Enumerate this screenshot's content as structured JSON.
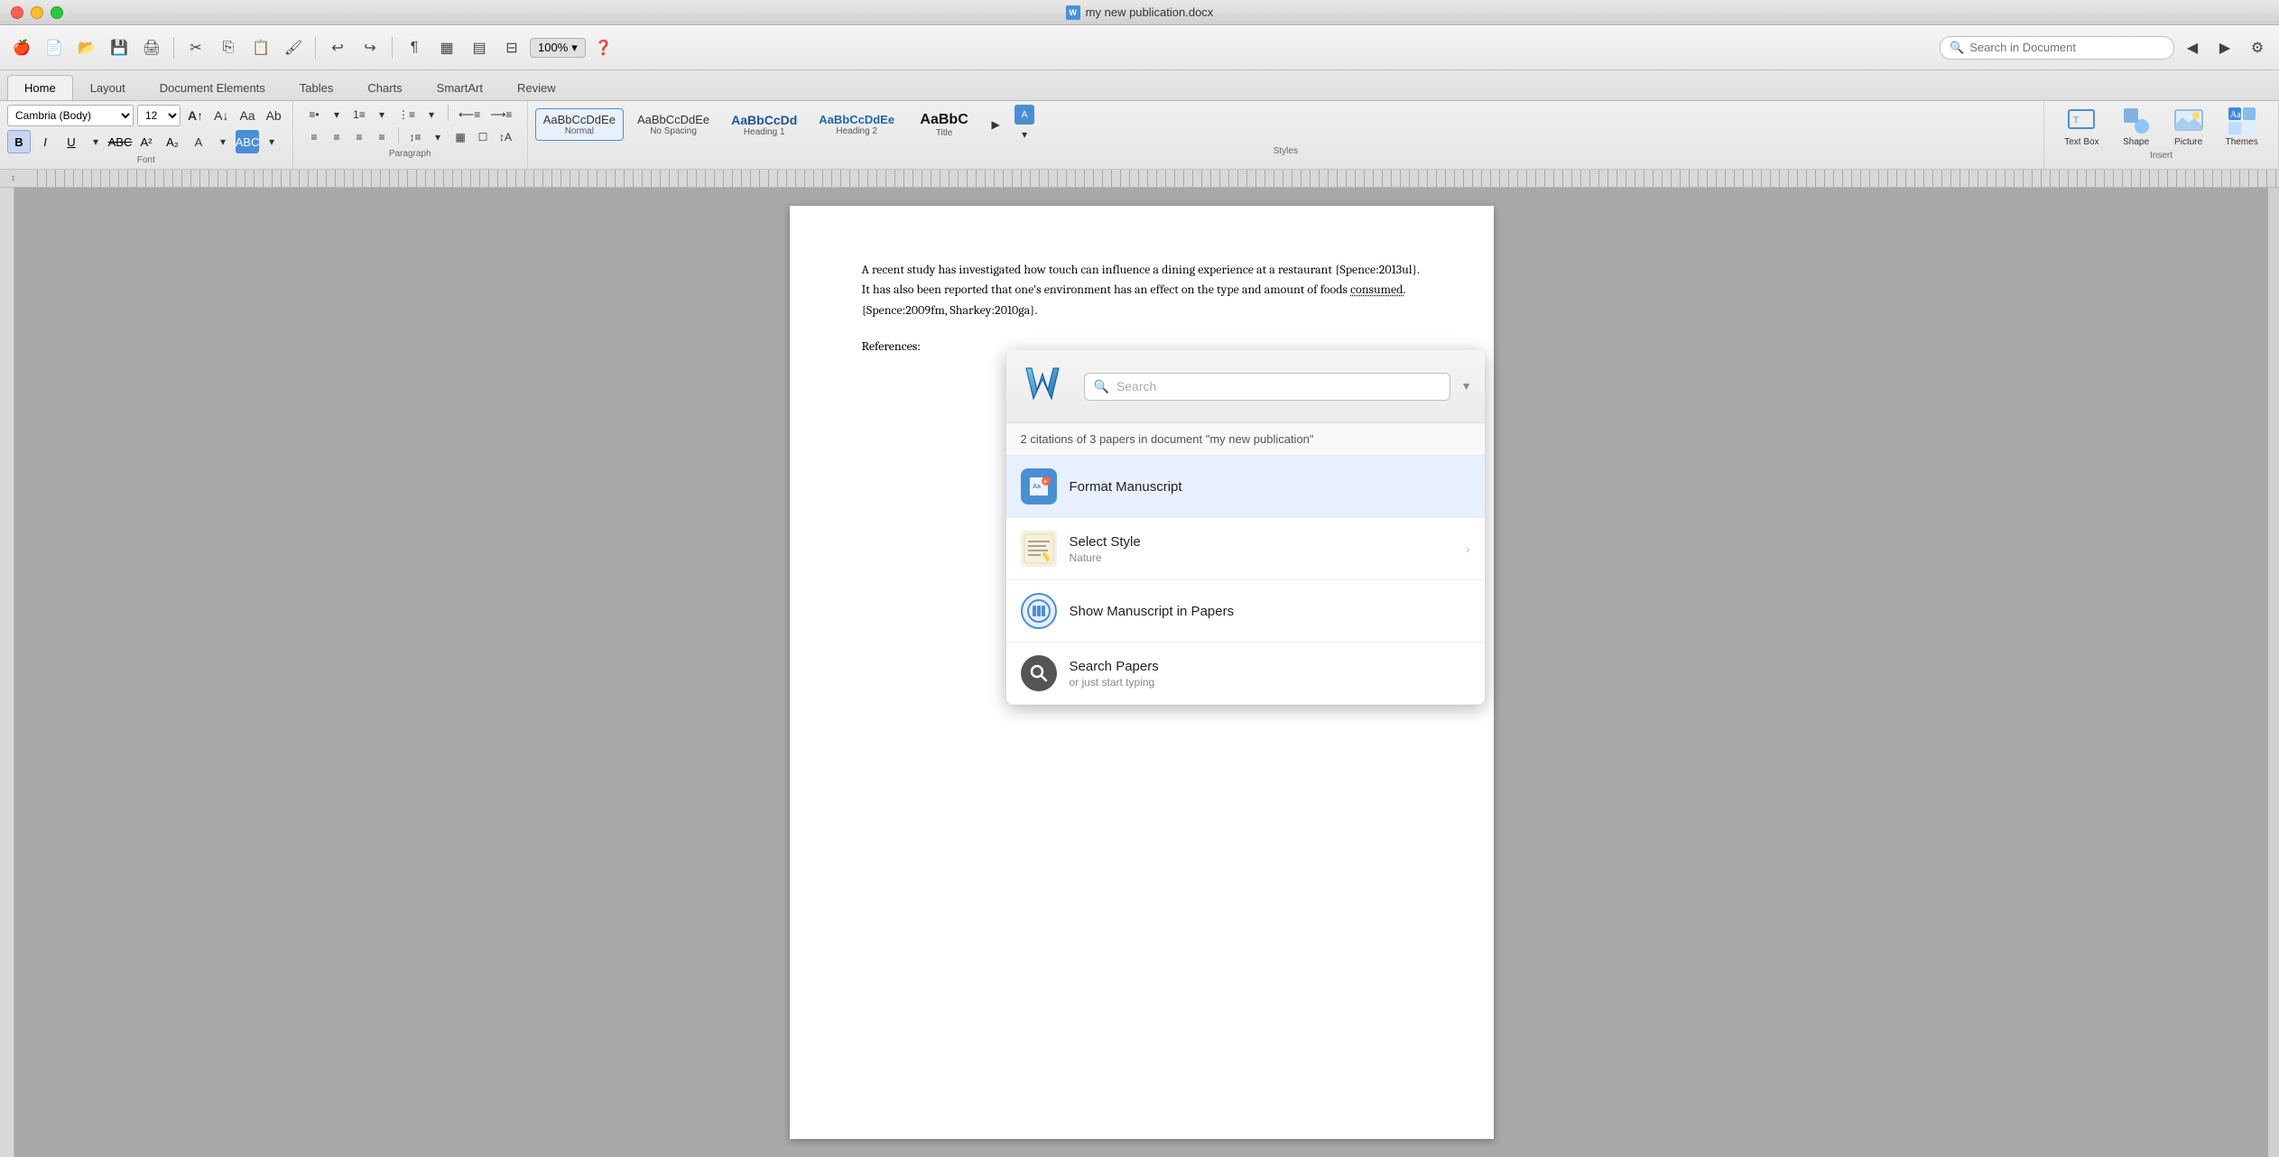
{
  "window": {
    "title": "my new publication.docx",
    "traffic_lights": [
      "close",
      "minimize",
      "maximize"
    ]
  },
  "toolbar": {
    "zoom": "100%",
    "search_placeholder": "Search in Document"
  },
  "tabs": [
    {
      "label": "Home",
      "active": true
    },
    {
      "label": "Layout",
      "active": false
    },
    {
      "label": "Document Elements",
      "active": false
    },
    {
      "label": "Tables",
      "active": false
    },
    {
      "label": "Charts",
      "active": false
    },
    {
      "label": "SmartArt",
      "active": false
    },
    {
      "label": "Review",
      "active": false
    }
  ],
  "ribbon": {
    "font_section_label": "Font",
    "paragraph_section_label": "Paragraph",
    "styles_section_label": "Styles",
    "insert_section_label": "Insert",
    "themes_section_label": "Themes",
    "font_name": "Cambria (Body)",
    "font_size": "12",
    "styles": [
      {
        "label": "Normal",
        "sublabel": "AaBbCcDdEe",
        "active": true
      },
      {
        "label": "No Spacing",
        "sublabel": "AaBbCcDdEe",
        "active": false
      },
      {
        "label": "Heading 1",
        "sublabel": "AaBbCcDd",
        "active": false
      },
      {
        "label": "Heading 2",
        "sublabel": "AaBbCcDdEe",
        "active": false
      },
      {
        "label": "Title",
        "sublabel": "AaBbC",
        "active": false
      }
    ],
    "insert_items": [
      {
        "label": "Text Box",
        "icon": "☐"
      },
      {
        "label": "Shape",
        "icon": "◇"
      },
      {
        "label": "Picture",
        "icon": "🖼"
      },
      {
        "label": "Themes",
        "icon": "🎨"
      }
    ]
  },
  "document": {
    "body_text": "A recent study has investigated how touch can influence a dining experience at a restaurant {Spence:2013ul}. It has also been reported that one's environment has an effect on the type and amount of foods consumed. {Spence:2009fm, Sharkey:2010ga}.",
    "references_label": "References:"
  },
  "papers_popup": {
    "search_placeholder": "Search",
    "info_text": "2 citations of 3 papers in document \"my new publication\"",
    "menu_items": [
      {
        "id": "format_manuscript",
        "title": "Format Manuscript",
        "subtitle": "",
        "has_arrow": false,
        "active": true
      },
      {
        "id": "select_style",
        "title": "Select Style",
        "subtitle": "Nature",
        "has_arrow": true,
        "active": false
      },
      {
        "id": "show_manuscript",
        "title": "Show Manuscript in Papers",
        "subtitle": "",
        "has_arrow": false,
        "active": false
      },
      {
        "id": "search_papers",
        "title": "Search Papers",
        "subtitle": "or just start typing",
        "has_arrow": false,
        "active": false
      }
    ]
  }
}
